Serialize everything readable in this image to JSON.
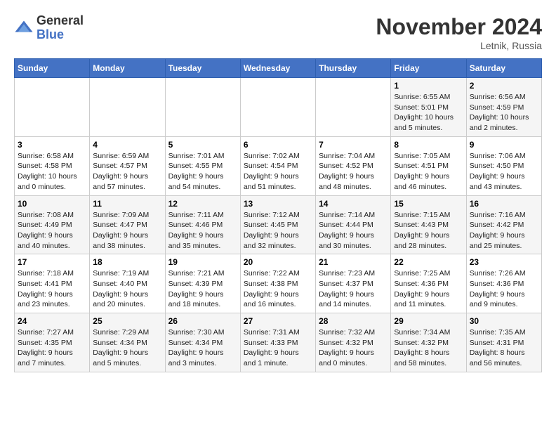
{
  "logo": {
    "general": "General",
    "blue": "Blue"
  },
  "title": "November 2024",
  "location": "Letnik, Russia",
  "days_header": [
    "Sunday",
    "Monday",
    "Tuesday",
    "Wednesday",
    "Thursday",
    "Friday",
    "Saturday"
  ],
  "weeks": [
    [
      {
        "day": "",
        "info": ""
      },
      {
        "day": "",
        "info": ""
      },
      {
        "day": "",
        "info": ""
      },
      {
        "day": "",
        "info": ""
      },
      {
        "day": "",
        "info": ""
      },
      {
        "day": "1",
        "info": "Sunrise: 6:55 AM\nSunset: 5:01 PM\nDaylight: 10 hours and 5 minutes."
      },
      {
        "day": "2",
        "info": "Sunrise: 6:56 AM\nSunset: 4:59 PM\nDaylight: 10 hours and 2 minutes."
      }
    ],
    [
      {
        "day": "3",
        "info": "Sunrise: 6:58 AM\nSunset: 4:58 PM\nDaylight: 10 hours and 0 minutes."
      },
      {
        "day": "4",
        "info": "Sunrise: 6:59 AM\nSunset: 4:57 PM\nDaylight: 9 hours and 57 minutes."
      },
      {
        "day": "5",
        "info": "Sunrise: 7:01 AM\nSunset: 4:55 PM\nDaylight: 9 hours and 54 minutes."
      },
      {
        "day": "6",
        "info": "Sunrise: 7:02 AM\nSunset: 4:54 PM\nDaylight: 9 hours and 51 minutes."
      },
      {
        "day": "7",
        "info": "Sunrise: 7:04 AM\nSunset: 4:52 PM\nDaylight: 9 hours and 48 minutes."
      },
      {
        "day": "8",
        "info": "Sunrise: 7:05 AM\nSunset: 4:51 PM\nDaylight: 9 hours and 46 minutes."
      },
      {
        "day": "9",
        "info": "Sunrise: 7:06 AM\nSunset: 4:50 PM\nDaylight: 9 hours and 43 minutes."
      }
    ],
    [
      {
        "day": "10",
        "info": "Sunrise: 7:08 AM\nSunset: 4:49 PM\nDaylight: 9 hours and 40 minutes."
      },
      {
        "day": "11",
        "info": "Sunrise: 7:09 AM\nSunset: 4:47 PM\nDaylight: 9 hours and 38 minutes."
      },
      {
        "day": "12",
        "info": "Sunrise: 7:11 AM\nSunset: 4:46 PM\nDaylight: 9 hours and 35 minutes."
      },
      {
        "day": "13",
        "info": "Sunrise: 7:12 AM\nSunset: 4:45 PM\nDaylight: 9 hours and 32 minutes."
      },
      {
        "day": "14",
        "info": "Sunrise: 7:14 AM\nSunset: 4:44 PM\nDaylight: 9 hours and 30 minutes."
      },
      {
        "day": "15",
        "info": "Sunrise: 7:15 AM\nSunset: 4:43 PM\nDaylight: 9 hours and 28 minutes."
      },
      {
        "day": "16",
        "info": "Sunrise: 7:16 AM\nSunset: 4:42 PM\nDaylight: 9 hours and 25 minutes."
      }
    ],
    [
      {
        "day": "17",
        "info": "Sunrise: 7:18 AM\nSunset: 4:41 PM\nDaylight: 9 hours and 23 minutes."
      },
      {
        "day": "18",
        "info": "Sunrise: 7:19 AM\nSunset: 4:40 PM\nDaylight: 9 hours and 20 minutes."
      },
      {
        "day": "19",
        "info": "Sunrise: 7:21 AM\nSunset: 4:39 PM\nDaylight: 9 hours and 18 minutes."
      },
      {
        "day": "20",
        "info": "Sunrise: 7:22 AM\nSunset: 4:38 PM\nDaylight: 9 hours and 16 minutes."
      },
      {
        "day": "21",
        "info": "Sunrise: 7:23 AM\nSunset: 4:37 PM\nDaylight: 9 hours and 14 minutes."
      },
      {
        "day": "22",
        "info": "Sunrise: 7:25 AM\nSunset: 4:36 PM\nDaylight: 9 hours and 11 minutes."
      },
      {
        "day": "23",
        "info": "Sunrise: 7:26 AM\nSunset: 4:36 PM\nDaylight: 9 hours and 9 minutes."
      }
    ],
    [
      {
        "day": "24",
        "info": "Sunrise: 7:27 AM\nSunset: 4:35 PM\nDaylight: 9 hours and 7 minutes."
      },
      {
        "day": "25",
        "info": "Sunrise: 7:29 AM\nSunset: 4:34 PM\nDaylight: 9 hours and 5 minutes."
      },
      {
        "day": "26",
        "info": "Sunrise: 7:30 AM\nSunset: 4:34 PM\nDaylight: 9 hours and 3 minutes."
      },
      {
        "day": "27",
        "info": "Sunrise: 7:31 AM\nSunset: 4:33 PM\nDaylight: 9 hours and 1 minute."
      },
      {
        "day": "28",
        "info": "Sunrise: 7:32 AM\nSunset: 4:32 PM\nDaylight: 9 hours and 0 minutes."
      },
      {
        "day": "29",
        "info": "Sunrise: 7:34 AM\nSunset: 4:32 PM\nDaylight: 8 hours and 58 minutes."
      },
      {
        "day": "30",
        "info": "Sunrise: 7:35 AM\nSunset: 4:31 PM\nDaylight: 8 hours and 56 minutes."
      }
    ]
  ]
}
